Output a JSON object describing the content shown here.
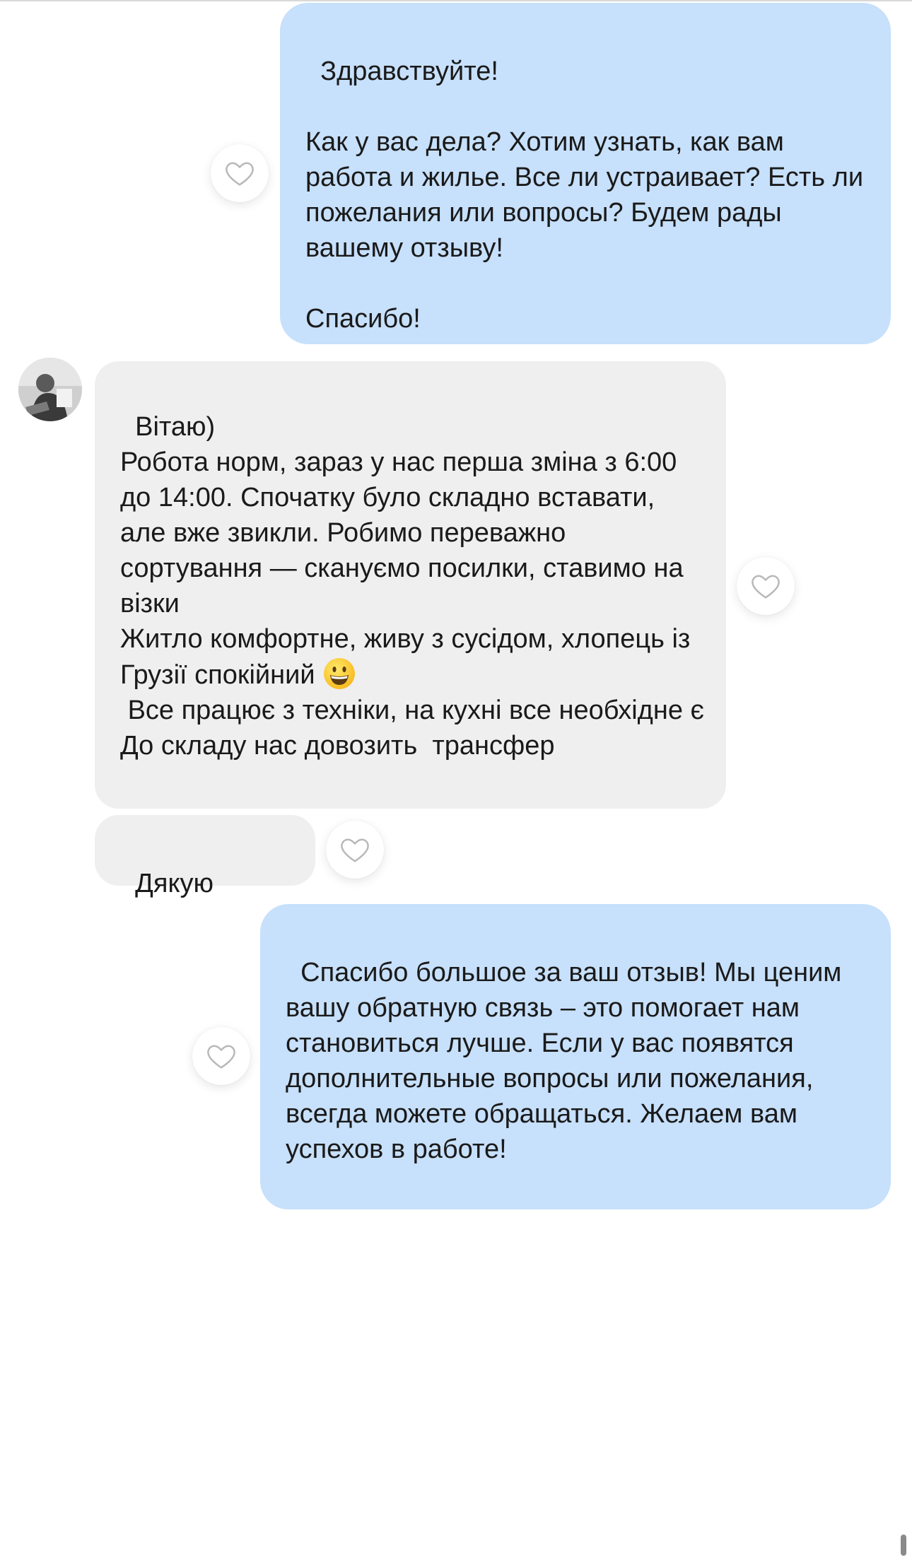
{
  "messages": [
    {
      "direction": "outgoing",
      "text": "Здравствуйте!\n\nКак у вас дела? Хотим узнать, как вам работа и жилье. Все ли устраивает? Есть ли пожелания или вопросы? Будем рады вашему отзыву!\n\nСпасибо!"
    },
    {
      "direction": "incoming",
      "text_before_emoji": "Вітаю)\nРобота норм, зараз у нас перша зміна з 6:00 до 14:00. Спочатку було складно вставати, але вже звикли. Робимо переважно сортування — скануємо посилки, ставимо на візки\nЖитло комфортне, живу з сусідом, хлопець із Грузії спокійний ",
      "emoji": "grinning-face",
      "text_after_emoji": "\n Все працює з техніки, на кухні все необхідне є\nДо складу нас довозить  трансфер"
    },
    {
      "direction": "incoming",
      "text": "Дякую"
    },
    {
      "direction": "outgoing",
      "text": "Спасибо большое за ваш отзыв! Мы ценим вашу обратную связь – это помогает нам становиться лучше. Если у вас появятся дополнительные вопросы или пожелания, всегда можете обращаться. Желаем вам успехов в работе!"
    }
  ],
  "icons": {
    "like": "heart-outline-icon",
    "avatar": "contact-avatar"
  },
  "colors": {
    "outgoing_bubble": "#c7e0fb",
    "incoming_bubble": "#efefef",
    "heart_stroke": "#b8b8b8"
  }
}
